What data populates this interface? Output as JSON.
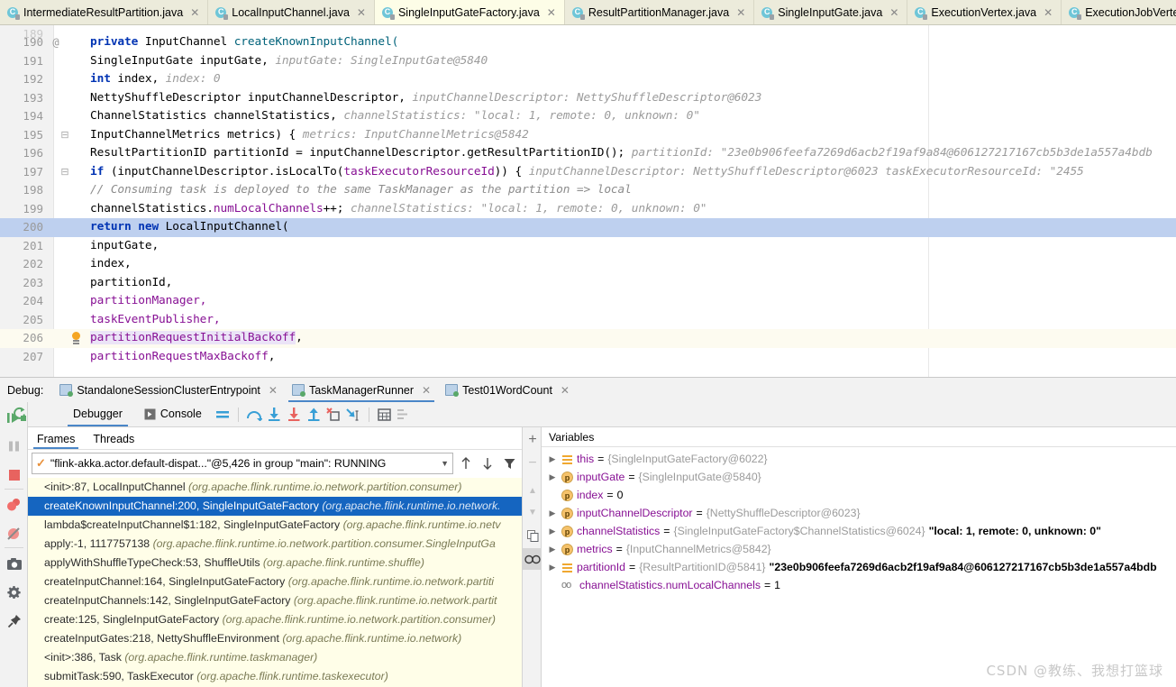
{
  "editor_tabs": [
    {
      "label": "IntermediateResultPartition.java",
      "icon": "java-class-icon",
      "active": false
    },
    {
      "label": "LocalInputChannel.java",
      "icon": "java-class-icon",
      "active": false
    },
    {
      "label": "SingleInputGateFactory.java",
      "icon": "java-class-icon",
      "active": true
    },
    {
      "label": "ResultPartitionManager.java",
      "icon": "java-class-icon",
      "active": false
    },
    {
      "label": "SingleInputGate.java",
      "icon": "java-class-icon",
      "active": false
    },
    {
      "label": "ExecutionVertex.java",
      "icon": "java-class-icon",
      "active": false
    },
    {
      "label": "ExecutionJobVertex.java",
      "icon": "java-class-icon",
      "active": false
    }
  ],
  "code": {
    "lines": [
      {
        "num": "189",
        "gutter": "",
        "indent": 0,
        "partial_top": true,
        "tokens": []
      },
      {
        "num": "190",
        "gutter": "@",
        "tokens": [
          {
            "t": "kw",
            "s": "private "
          },
          {
            "t": "pl",
            "s": "InputChannel "
          },
          {
            "t": "mcall",
            "s": "createKnownInputChannel("
          }
        ]
      },
      {
        "num": "191",
        "gutter": "",
        "tokens": [
          {
            "t": "pl",
            "s": "        SingleInputGate inputGate,  "
          },
          {
            "t": "hint",
            "s": "inputGate: SingleInputGate@5840"
          }
        ]
      },
      {
        "num": "192",
        "gutter": "",
        "tokens": [
          {
            "t": "pl",
            "s": "        "
          },
          {
            "t": "kw",
            "s": "int"
          },
          {
            "t": "pl",
            "s": " index,  "
          },
          {
            "t": "hint",
            "s": "index: 0"
          }
        ]
      },
      {
        "num": "193",
        "gutter": "",
        "tokens": [
          {
            "t": "pl",
            "s": "        NettyShuffleDescriptor inputChannelDescriptor,  "
          },
          {
            "t": "hint",
            "s": "inputChannelDescriptor: NettyShuffleDescriptor@6023"
          }
        ]
      },
      {
        "num": "194",
        "gutter": "",
        "tokens": [
          {
            "t": "pl",
            "s": "        ChannelStatistics channelStatistics,  "
          },
          {
            "t": "hint",
            "s": "channelStatistics: \"local: 1, remote: 0, unknown: 0\""
          }
        ]
      },
      {
        "num": "195",
        "gutter": "",
        "fold": true,
        "tokens": [
          {
            "t": "pl",
            "s": "        InputChannelMetrics metrics) {  "
          },
          {
            "t": "hint",
            "s": "metrics: InputChannelMetrics@5842"
          }
        ]
      },
      {
        "num": "196",
        "gutter": "",
        "tokens": [
          {
            "t": "pl",
            "s": "    ResultPartitionID partitionId = inputChannelDescriptor.getResultPartitionID();  "
          },
          {
            "t": "hint",
            "s": "partitionId: \"23e0b906feefa7269d6acb2f19af9a84@606127217167cb5b3de1a557a4bdb"
          }
        ]
      },
      {
        "num": "197",
        "gutter": "",
        "fold": true,
        "tokens": [
          {
            "t": "pl",
            "s": "    "
          },
          {
            "t": "kw",
            "s": "if"
          },
          {
            "t": "pl",
            "s": " (inputChannelDescriptor.isLocalTo("
          },
          {
            "t": "fld",
            "s": "taskExecutorResourceId"
          },
          {
            "t": "pl",
            "s": ")) {  "
          },
          {
            "t": "hint",
            "s": "inputChannelDescriptor: NettyShuffleDescriptor@6023   taskExecutorResourceId: \"2455"
          }
        ]
      },
      {
        "num": "198",
        "gutter": "",
        "tokens": [
          {
            "t": "cmt",
            "s": "        // Consuming task is deployed to the same TaskManager as the partition => local"
          }
        ]
      },
      {
        "num": "199",
        "gutter": "",
        "tokens": [
          {
            "t": "pl",
            "s": "        channelStatistics."
          },
          {
            "t": "fld",
            "s": "numLocalChannels"
          },
          {
            "t": "pl",
            "s": "++;  "
          },
          {
            "t": "hint",
            "s": "channelStatistics: \"local: 1, remote: 0, unknown: 0\""
          }
        ]
      },
      {
        "num": "200",
        "gutter": "",
        "highlight": true,
        "tokens": [
          {
            "t": "pl",
            "s": "        "
          },
          {
            "t": "kw",
            "s": "return new"
          },
          {
            "t": "pl",
            "s": " LocalInputChannel("
          }
        ]
      },
      {
        "num": "201",
        "gutter": "",
        "tokens": [
          {
            "t": "pl",
            "s": "                inputGate,"
          }
        ]
      },
      {
        "num": "202",
        "gutter": "",
        "tokens": [
          {
            "t": "pl",
            "s": "                index,"
          }
        ]
      },
      {
        "num": "203",
        "gutter": "",
        "tokens": [
          {
            "t": "pl",
            "s": "                partitionId,"
          }
        ]
      },
      {
        "num": "204",
        "gutter": "",
        "tokens": [
          {
            "t": "fld",
            "s": "                partitionManager,"
          }
        ]
      },
      {
        "num": "205",
        "gutter": "",
        "tokens": [
          {
            "t": "fld",
            "s": "                taskEventPublisher,"
          }
        ]
      },
      {
        "num": "206",
        "gutter": "",
        "bulb": true,
        "tokens": [
          {
            "t": "fld hlword",
            "s": "                partitionRequestInitialBackoff"
          },
          {
            "t": "pl",
            "s": ","
          }
        ]
      },
      {
        "num": "207",
        "gutter": "",
        "tokens": [
          {
            "t": "fld",
            "s": "                partitionRequestMaxBackoff"
          },
          {
            "t": "pl",
            "s": ","
          }
        ]
      }
    ]
  },
  "debug_header": {
    "label": "Debug:",
    "configs": [
      {
        "label": "StandaloneSessionClusterEntrypoint",
        "active": false
      },
      {
        "label": "TaskManagerRunner",
        "active": true
      },
      {
        "label": "Test01WordCount",
        "active": false
      }
    ]
  },
  "debug_toolbar": {
    "rerun_icon": "rerun-icon",
    "tabs": [
      {
        "label": "Debugger",
        "icon": "",
        "active": true
      },
      {
        "label": "Console",
        "icon": "console-icon",
        "active": false
      }
    ],
    "icons": [
      "layout-settings-icon",
      "step-over-icon",
      "step-into-icon",
      "force-step-into-icon",
      "step-out-icon",
      "drop-frame-icon",
      "run-to-cursor-icon",
      "evaluate-expression-icon",
      "mute-breakpoints-icon"
    ]
  },
  "left_toolbar": {
    "buttons": [
      {
        "name": "resume-program-icon",
        "glyph": "resume"
      },
      {
        "name": "pause-program-icon",
        "glyph": "pause"
      },
      {
        "name": "stop-icon",
        "glyph": "stop"
      },
      {
        "name": "view-breakpoints-icon",
        "glyph": "breakpoints"
      },
      {
        "name": "mute-breakpoints-icon",
        "glyph": "mute"
      },
      {
        "name": "screenshot-icon",
        "glyph": "camera"
      },
      {
        "name": "settings-icon",
        "glyph": "gear"
      },
      {
        "name": "pin-tab-icon",
        "glyph": "pin"
      }
    ]
  },
  "frames": {
    "tabs": [
      {
        "label": "Frames",
        "active": true
      },
      {
        "label": "Threads",
        "active": false
      }
    ],
    "thread_selector": {
      "value": "\"flink-akka.actor.default-dispat...\"@5,426 in group \"main\": RUNNING",
      "status_icon": "check-icon",
      "caret_icon": "chevron-down-icon"
    },
    "side_icons": [
      "arrow-up-icon",
      "arrow-down-icon",
      "filter-icon"
    ],
    "items": [
      {
        "method": "<init>:87, LocalInputChannel",
        "pkg": "(org.apache.flink.runtime.io.network.partition.consumer)",
        "selected": false
      },
      {
        "method": "createKnownInputChannel:200, SingleInputGateFactory",
        "pkg": "(org.apache.flink.runtime.io.network.",
        "selected": true
      },
      {
        "method": "lambda$createInputChannel$1:182, SingleInputGateFactory",
        "pkg": "(org.apache.flink.runtime.io.netv",
        "selected": false
      },
      {
        "method": "apply:-1, 1117757138",
        "pkg": "(org.apache.flink.runtime.io.network.partition.consumer.SingleInputGa",
        "selected": false
      },
      {
        "method": "applyWithShuffleTypeCheck:53, ShuffleUtils",
        "pkg": "(org.apache.flink.runtime.shuffle)",
        "selected": false
      },
      {
        "method": "createInputChannel:164, SingleInputGateFactory",
        "pkg": "(org.apache.flink.runtime.io.network.partiti",
        "selected": false
      },
      {
        "method": "createInputChannels:142, SingleInputGateFactory",
        "pkg": "(org.apache.flink.runtime.io.network.partit",
        "selected": false
      },
      {
        "method": "create:125, SingleInputGateFactory",
        "pkg": "(org.apache.flink.runtime.io.network.partition.consumer)",
        "selected": false
      },
      {
        "method": "createInputGates:218, NettyShuffleEnvironment",
        "pkg": "(org.apache.flink.runtime.io.network)",
        "selected": false
      },
      {
        "method": "<init>:386, Task",
        "pkg": "(org.apache.flink.runtime.taskmanager)",
        "selected": false
      },
      {
        "method": "submitTask:590, TaskExecutor",
        "pkg": "(org.apache.flink.runtime.taskexecutor)",
        "selected": false
      }
    ]
  },
  "vars_side_icons": [
    "add-watch-icon",
    "remove-watch-icon",
    "move-up-icon",
    "move-down-icon",
    "copy-icon",
    "inspect-icon"
  ],
  "variables": {
    "title": "Variables",
    "items": [
      {
        "expandable": true,
        "icon": "field-icon",
        "name": "this",
        "eq": " = ",
        "type": "{SingleInputGateFactory@6022}",
        "value": ""
      },
      {
        "expandable": true,
        "icon": "param-icon",
        "name": "inputGate",
        "eq": " = ",
        "type": "{SingleInputGate@5840}",
        "value": ""
      },
      {
        "expandable": false,
        "icon": "param-icon",
        "name": "index",
        "eq": " = ",
        "type": "",
        "value": "0"
      },
      {
        "expandable": true,
        "icon": "param-icon",
        "name": "inputChannelDescriptor",
        "eq": " = ",
        "type": "{NettyShuffleDescriptor@6023}",
        "value": ""
      },
      {
        "expandable": true,
        "icon": "param-icon",
        "name": "channelStatistics",
        "eq": " = ",
        "type": "{SingleInputGateFactory$ChannelStatistics@6024}",
        "value": "\"local: 1, remote: 0, unknown: 0\""
      },
      {
        "expandable": true,
        "icon": "param-icon",
        "name": "metrics",
        "eq": " = ",
        "type": "{InputChannelMetrics@5842}",
        "value": ""
      },
      {
        "expandable": true,
        "icon": "field-icon",
        "name": "partitionId",
        "eq": " = ",
        "type": "{ResultPartitionID@5841}",
        "value": "\"23e0b906feefa7269d6acb2f19af9a84@606127217167cb5b3de1a557a4bdb"
      },
      {
        "expandable": false,
        "icon": "watch-icon",
        "name": "channelStatistics.numLocalChannels",
        "eq": " = ",
        "type": "",
        "value": "1"
      }
    ]
  },
  "watermark": "CSDN @教练、我想打篮球",
  "colors": {
    "tab_bar": "#ecebdb",
    "active_tab": "#fdfde7",
    "current_line": "#bed0ef",
    "frames_bg": "#fffee8",
    "frame_selected": "#1565c0",
    "accent": "#4a86c8",
    "keyword": "#0033b3",
    "field": "#871094",
    "hint": "#9b9b9b"
  }
}
